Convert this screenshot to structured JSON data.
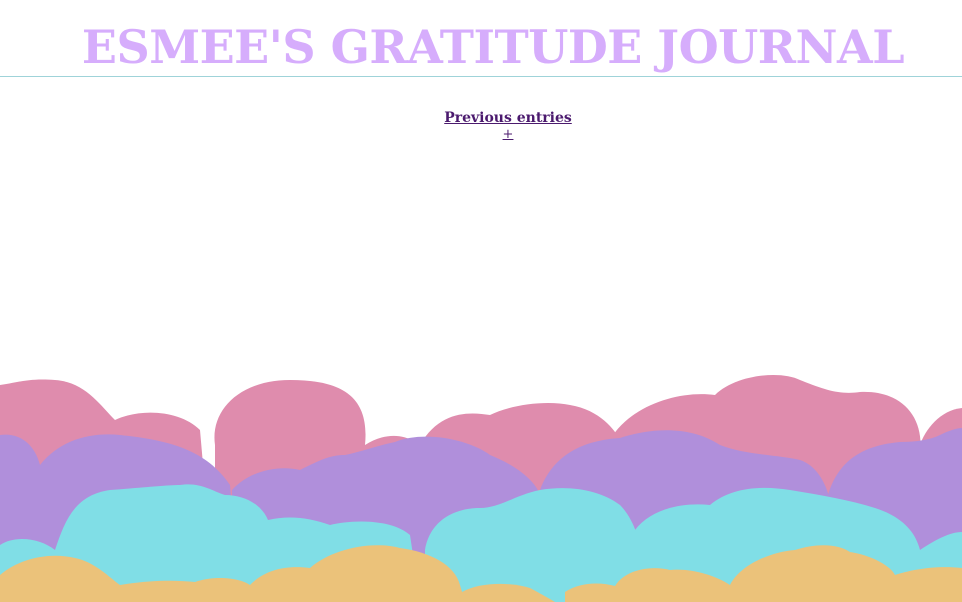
{
  "header": {
    "title": "ESMEE'S GRATITUDE JOURNAL"
  },
  "nav": {
    "previous_entries_label": "Previous entries",
    "add_label": "+"
  },
  "colors": {
    "title": "#d6adfc",
    "link": "#4b1a6e",
    "divider": "#9fd3d9",
    "cloud_pink": "#df8cad",
    "cloud_purple": "#b08fdb",
    "cloud_cyan": "#80dee6",
    "cloud_yellow": "#ebc27a"
  }
}
